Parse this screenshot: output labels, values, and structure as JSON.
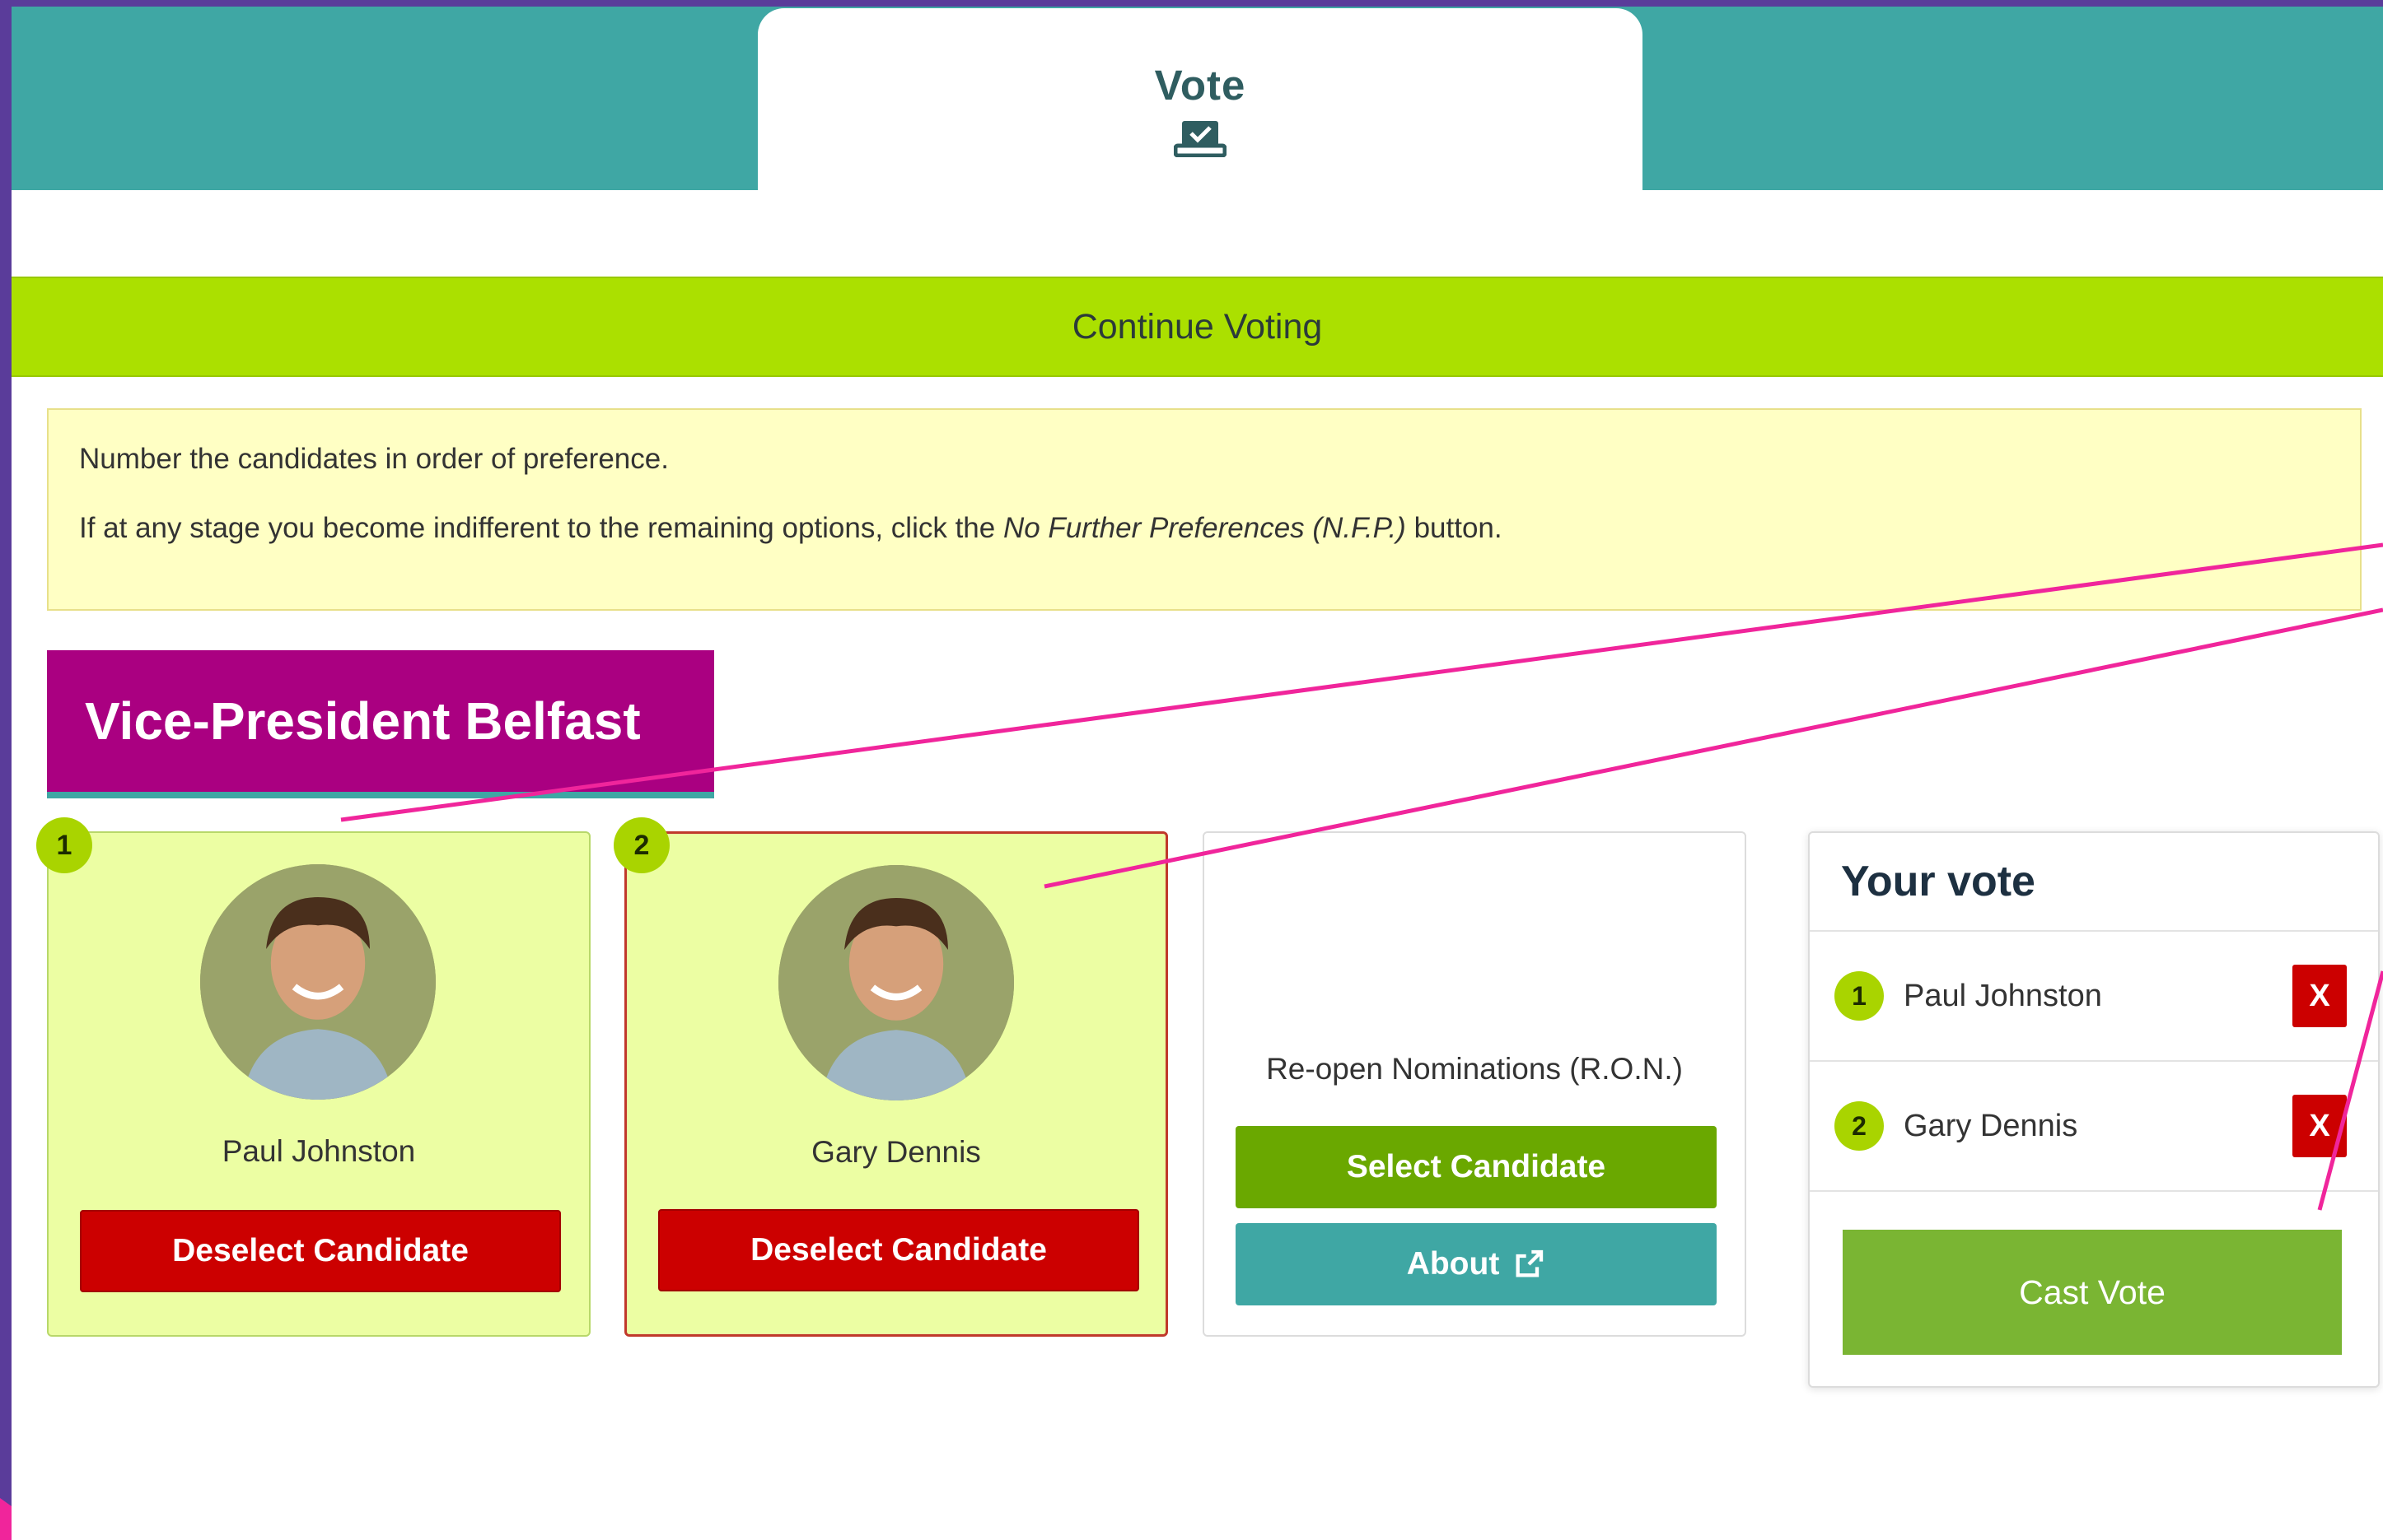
{
  "header": {
    "tab_label": "Vote",
    "tab_icon": "ballot-box-icon"
  },
  "continue_bar": {
    "label": "Continue Voting"
  },
  "instructions": {
    "line1": "Number the candidates in order of preference.",
    "line2_prefix": "If at any stage you become indifferent to the remaining options, click the ",
    "line2_emphasis": "No Further Preferences (N.F.P.)",
    "line2_suffix": " button."
  },
  "section": {
    "title": "Vice-President Belfast"
  },
  "candidates": [
    {
      "rank": "1",
      "name": "Paul Johnston",
      "button": "Deselect Candidate"
    },
    {
      "rank": "2",
      "name": "Gary Dennis",
      "button": "Deselect Candidate"
    }
  ],
  "ron": {
    "label": "Re-open Nominations (R.O.N.)",
    "select_button": "Select Candidate",
    "about_button": "About"
  },
  "your_vote": {
    "title": "Your vote",
    "entries": [
      {
        "rank": "1",
        "name": "Paul Johnston",
        "remove": "X"
      },
      {
        "rank": "2",
        "name": "Gary Dennis",
        "remove": "X"
      }
    ],
    "cast_button": "Cast Vote"
  },
  "colors": {
    "teal": "#3fa7a4",
    "lime": "#abe000",
    "magenta": "#aa0081",
    "red": "#cc0000",
    "green": "#6aa800",
    "annotation": "#f0259b"
  }
}
